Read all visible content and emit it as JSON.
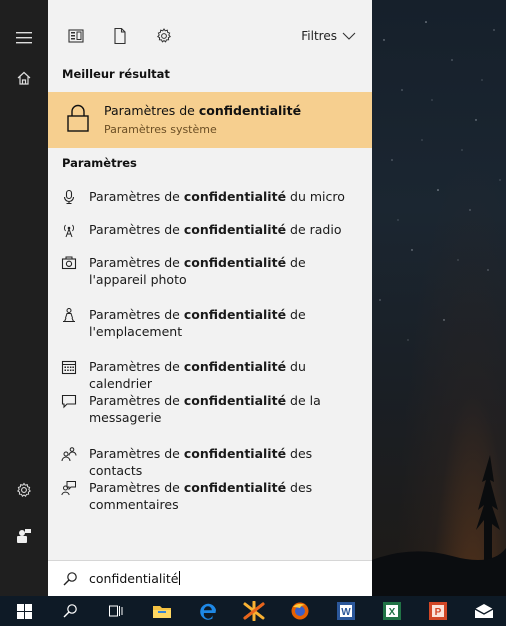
{
  "toolbar": {
    "filters_label": "Filtres",
    "icons": [
      "apps-icon",
      "document-icon",
      "gear-icon"
    ]
  },
  "rail": {
    "icons": [
      "hamburger-menu-icon",
      "home-icon",
      "settings-gear-icon",
      "user-feedback-icon"
    ]
  },
  "best_match": {
    "section": "Meilleur résultat",
    "title_prefix": "Paramètres de ",
    "title_bold": "confidentialité",
    "subtitle": "Paramètres système",
    "icon": "lock-icon"
  },
  "settings": {
    "section": "Paramètres",
    "items": [
      {
        "icon": "microphone-icon",
        "pre": "Paramètres de ",
        "bold": "confidentialité",
        "post": " du micro"
      },
      {
        "icon": "radio-antenna-icon",
        "pre": "Paramètres de ",
        "bold": "confidentialité",
        "post": " de radio"
      },
      {
        "icon": "camera-icon",
        "pre": "Paramètres de ",
        "bold": "confidentialité",
        "post": " de l'appareil photo"
      },
      {
        "icon": "location-person-icon",
        "pre": "Paramètres de ",
        "bold": "confidentialité",
        "post": " de l'emplacement"
      },
      {
        "icon": "calendar-icon",
        "pre": "Paramètres de ",
        "bold": "confidentialité",
        "post": " du calendrier"
      },
      {
        "icon": "message-icon",
        "pre": "Paramètres de ",
        "bold": "confidentialité",
        "post": " de la messagerie"
      },
      {
        "icon": "contacts-icon",
        "pre": "Paramètres de ",
        "bold": "confidentialité",
        "post": " des contacts"
      },
      {
        "icon": "feedback-person-icon",
        "pre": "Paramètres de ",
        "bold": "confidentialité",
        "post": " des commentaires"
      }
    ]
  },
  "search": {
    "value": "confidentialité",
    "icon": "search-icon"
  },
  "taskbar": {
    "icons": [
      "windows-start-icon",
      "cortana-search-icon",
      "task-view-icon",
      "file-explorer-icon",
      "edge-icon",
      "kaleidoscope-icon",
      "firefox-icon",
      "word-icon",
      "excel-icon",
      "powerpoint-icon",
      "mail-icon"
    ],
    "word_letter": "W",
    "excel_letter": "X",
    "powerpoint_letter": "P"
  },
  "colors": {
    "highlight": "#f6cf8f",
    "panel": "#f2f2f2",
    "rail": "#1f1f1f",
    "taskbar": "#0e1a26"
  }
}
